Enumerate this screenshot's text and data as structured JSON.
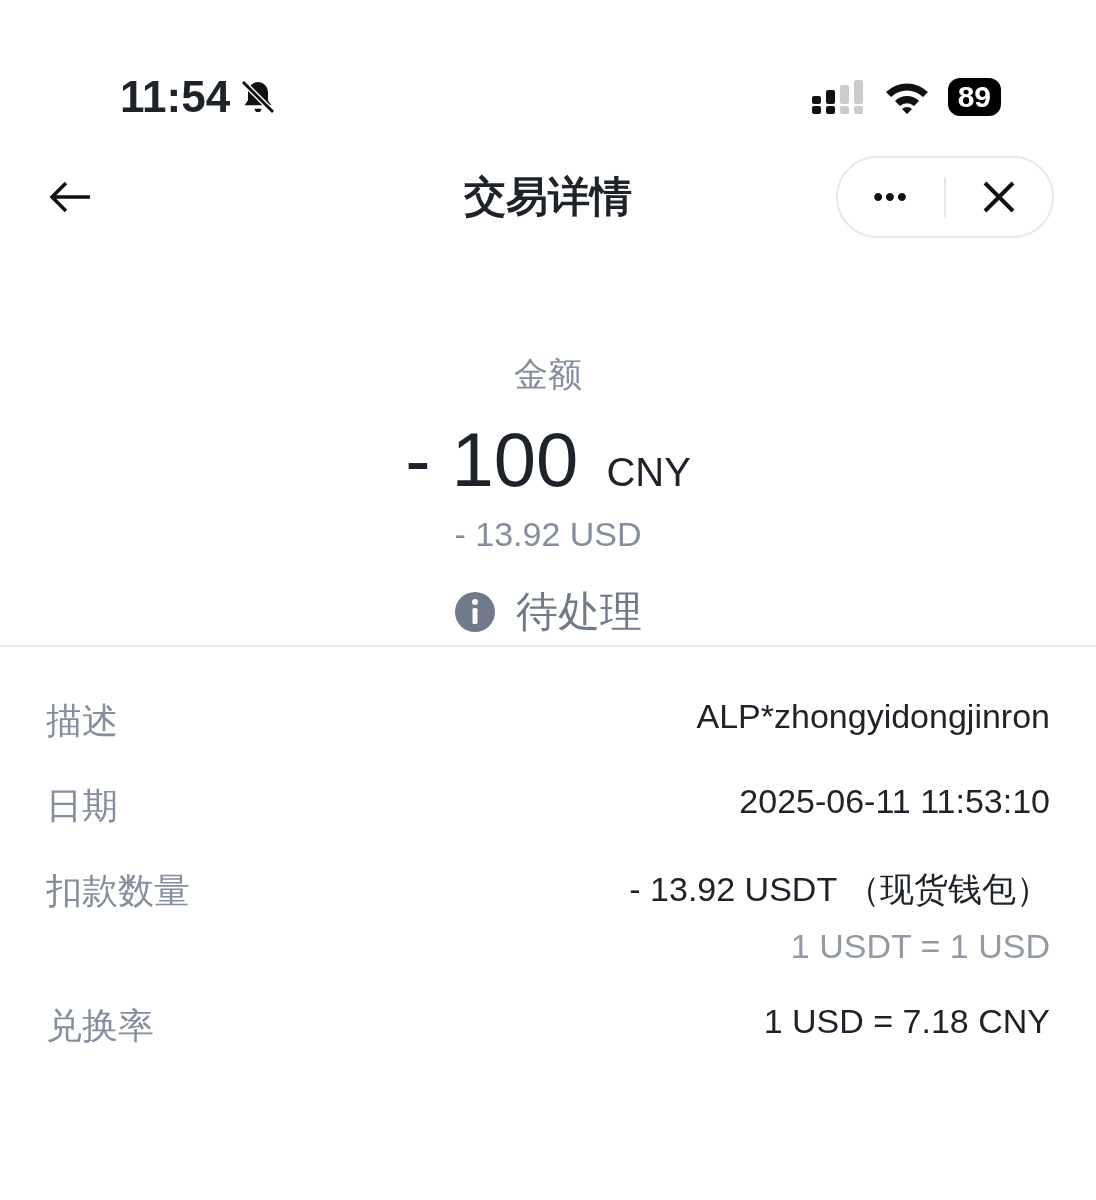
{
  "status_bar": {
    "time": "11:54",
    "battery": "89"
  },
  "header": {
    "title": "交易详情",
    "more": "•••"
  },
  "amount": {
    "label": "金额",
    "sign": "-",
    "value": "100",
    "currency": "CNY",
    "converted": "- 13.92 USD"
  },
  "status": {
    "text": "待处理"
  },
  "details": [
    {
      "label": "描述",
      "value": "ALP*zhongyidongjinron"
    },
    {
      "label": "日期",
      "value": "2025-06-11 11:53:10"
    },
    {
      "label": "扣款数量",
      "value": "- 13.92 USDT （现货钱包）",
      "sub": "1 USDT = 1 USD"
    },
    {
      "label": "兑换率",
      "value": "1 USD = 7.18 CNY"
    }
  ]
}
